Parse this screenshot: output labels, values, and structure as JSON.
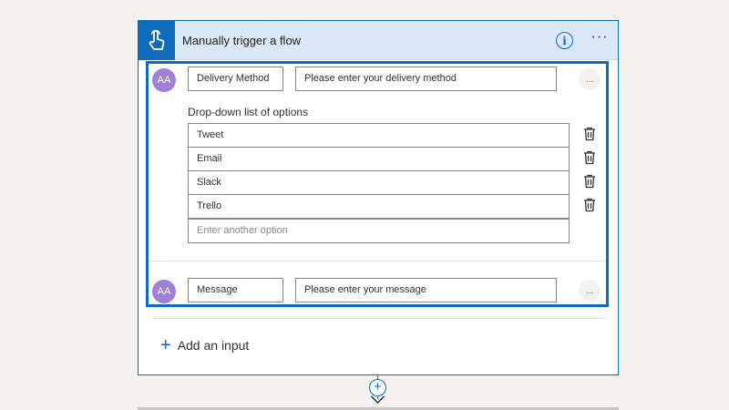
{
  "trigger": {
    "title": "Manually trigger a flow",
    "icon": "touch-hand-icon",
    "accent_color": "#0f6cbd"
  },
  "inputs": [
    {
      "avatar_text": "AA",
      "name": "Delivery Method",
      "placeholder": "Please enter your delivery method",
      "type": "text",
      "more_label": "..."
    },
    {
      "avatar_text": "AA",
      "name": "Message",
      "placeholder": "Please enter your message",
      "type": "text",
      "more_label": "..."
    }
  ],
  "dropdown": {
    "label": "Drop-down list of options",
    "options": [
      "Tweet",
      "Email",
      "Slack",
      "Trello"
    ],
    "add_placeholder": "Enter another option"
  },
  "add_input": {
    "label": "Add an input"
  }
}
